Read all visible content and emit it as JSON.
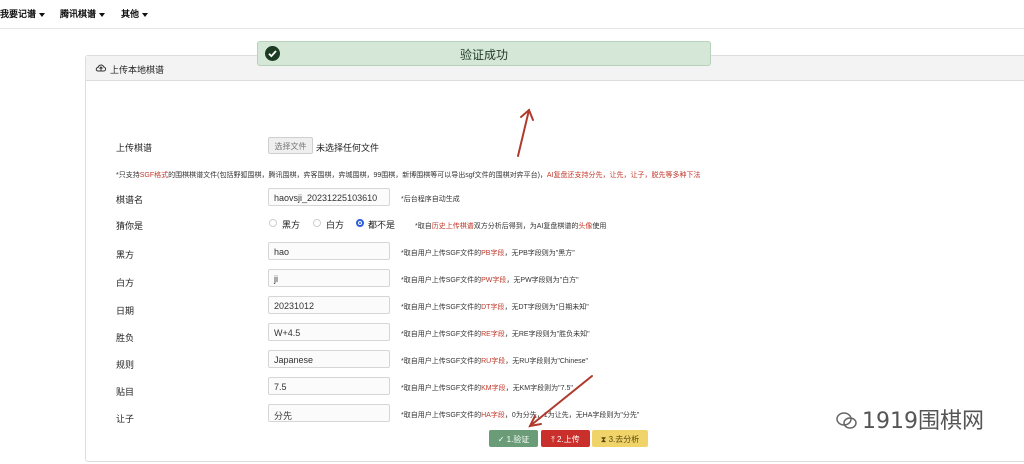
{
  "nav": {
    "items": [
      "我要记谱",
      "腾讯棋谱",
      "其他"
    ]
  },
  "card": {
    "title": "上传本地棋谱"
  },
  "success": {
    "text": "验证成功"
  },
  "upload": {
    "label": "上传棋谱",
    "button": "选择文件",
    "status": "未选择任何文件"
  },
  "note": {
    "prefix": "*只支持",
    "sgf": "SGF格式",
    "middle": "的围棋棋谱文件(包括野狐围棋，腾讯围棋，弈客围棋，弈城围棋，99围棋，新博围棋等可以导出sgf文件的围棋对弈平台)，",
    "ai": "AI复盘还支持分先，让先，让子，脱先等多种下法"
  },
  "fields": {
    "name": {
      "label": "棋谱名",
      "value": "haovsji_20231225103610",
      "hint": "*后台程序自动生成"
    },
    "guess": {
      "label": "猜你是",
      "options": [
        "黑方",
        "白方",
        "都不是"
      ],
      "selected": "都不是",
      "hint_a": "*取自",
      "hint_red": "历史上传棋谱",
      "hint_b": "双方分析后得到，为AI复盘棋谱的",
      "hint_red2": "头像",
      "hint_c": "使用"
    },
    "black": {
      "label": "黑方",
      "value": "hao",
      "hint_a": "*取自用户上传SGF文件的",
      "hint_red": "PB字段",
      "hint_b": "，无PB字段则为\"黑方\""
    },
    "white": {
      "label": "白方",
      "value": "ji",
      "hint_a": "*取自用户上传SGF文件的",
      "hint_red": "PW字段",
      "hint_b": "，无PW字段则为\"白方\""
    },
    "date": {
      "label": "日期",
      "value": "20231012",
      "hint_a": "*取自用户上传SGF文件的",
      "hint_red": "DT字段",
      "hint_b": "，无DT字段则为\"日期未知\""
    },
    "result": {
      "label": "胜负",
      "value": "W+4.5",
      "hint_a": "*取自用户上传SGF文件的",
      "hint_red": "RE字段",
      "hint_b": "，无RE字段则为\"胜负未知\""
    },
    "rule": {
      "label": "规则",
      "value": "Japanese",
      "hint_a": "*取自用户上传SGF文件的",
      "hint_red": "RU字段",
      "hint_b": "，无RU字段则为\"Chinese\""
    },
    "komi": {
      "label": "贴目",
      "value": "7.5",
      "hint_a": "*取自用户上传SGF文件的",
      "hint_red": "KM字段",
      "hint_b": "，无KM字段则为\"7.5\""
    },
    "handicap": {
      "label": "让子",
      "value": "分先",
      "hint_a": "*取自用户上传SGF文件的",
      "hint_red": "HA字段",
      "hint_b": "，0为分先，1为让先，无HA字段则为\"分先\""
    }
  },
  "buttons": {
    "verify": {
      "label": "1.验证",
      "color": "#6a9d77"
    },
    "upload": {
      "label": "2.上传",
      "color": "#c9302c"
    },
    "analyze": {
      "label": "3.去分析",
      "color": "#f0d46a"
    }
  },
  "watermark": {
    "text": "1919围棋网"
  }
}
